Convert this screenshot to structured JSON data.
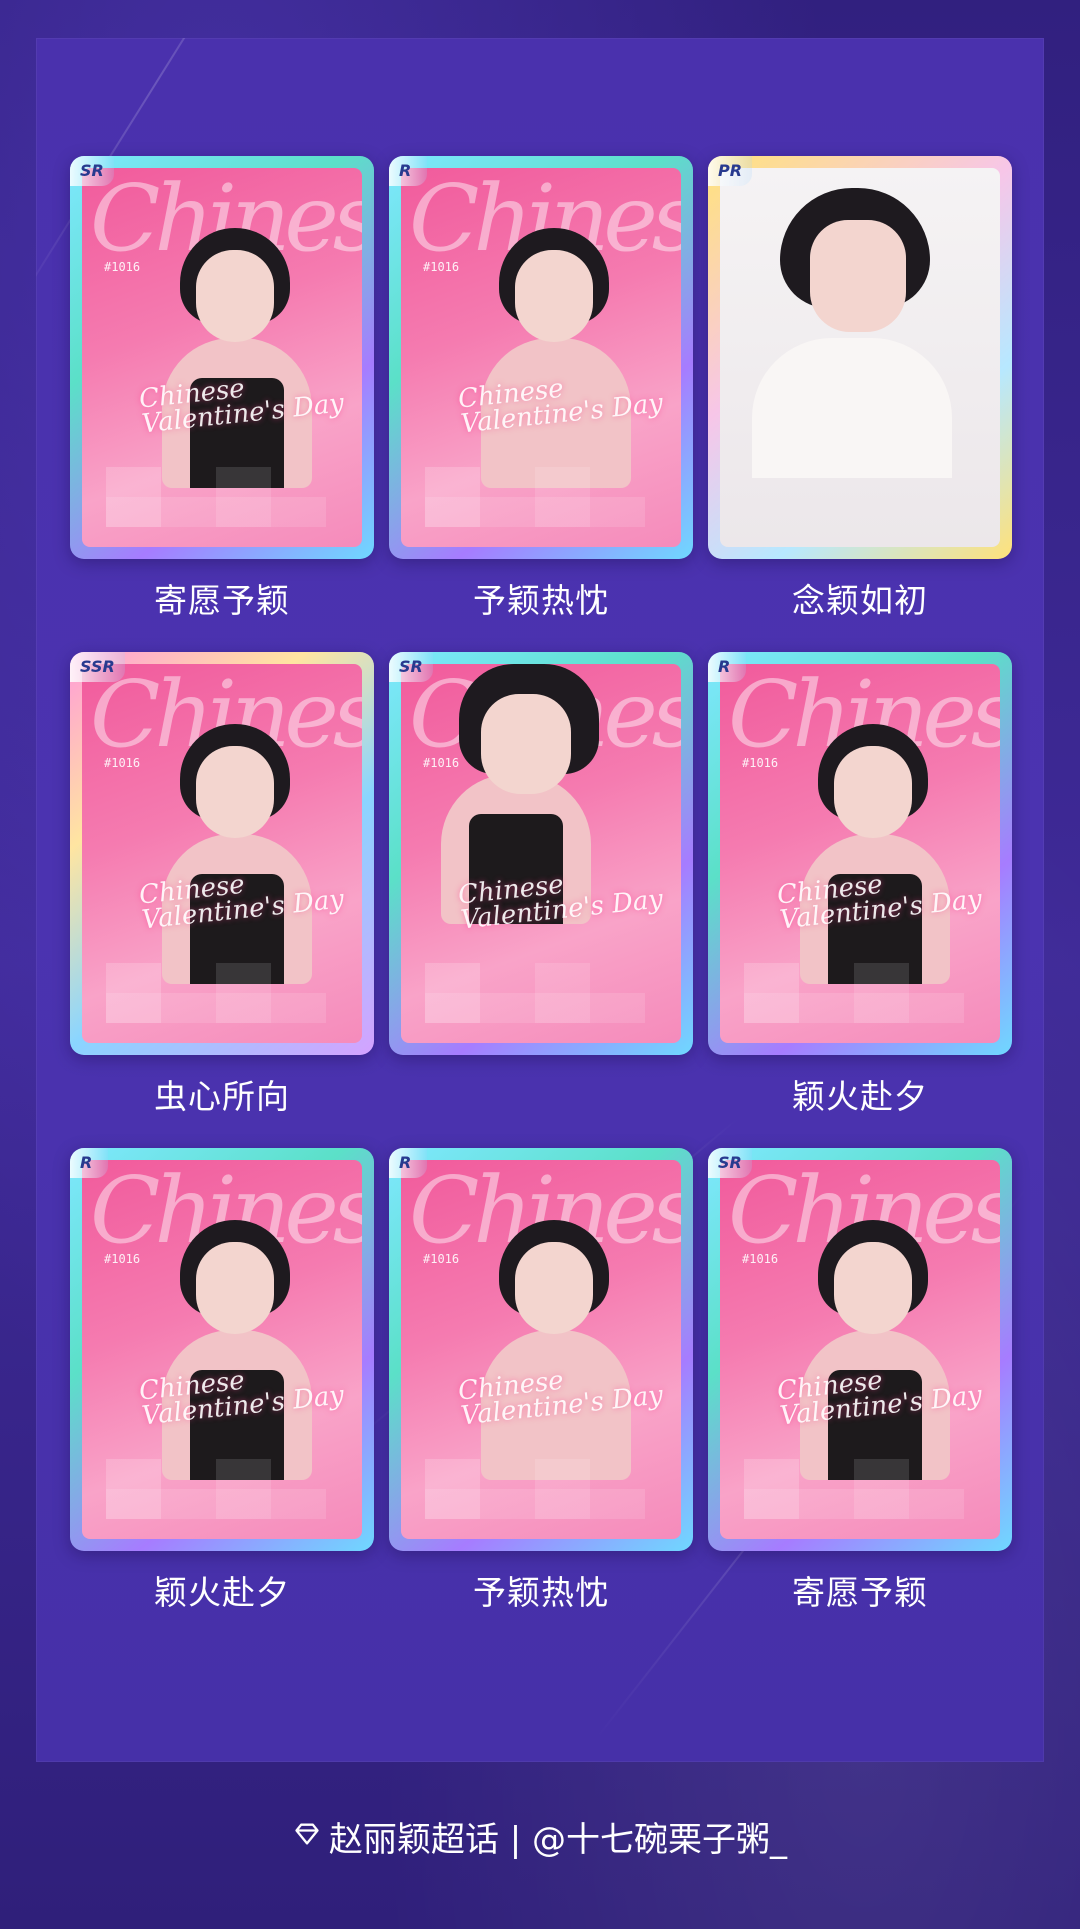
{
  "cards": [
    {
      "rarity": "SR",
      "name": "寄愿予颖"
    },
    {
      "rarity": "R",
      "name": "予颖热忱"
    },
    {
      "rarity": "PR",
      "name": "念颖如初"
    },
    {
      "rarity": "SSR",
      "name": "虫心所向"
    },
    {
      "rarity": "SR",
      "name": ""
    },
    {
      "rarity": "R",
      "name": "颖火赴夕"
    },
    {
      "rarity": "R",
      "name": "颖火赴夕"
    },
    {
      "rarity": "R",
      "name": "予颖热忱"
    },
    {
      "rarity": "SR",
      "name": "寄愿予颖"
    }
  ],
  "card_text": {
    "script": "Chinese",
    "number": "#1016",
    "valentine": "Chinese Valentine's Day"
  },
  "footer": {
    "icon": "diamond-icon",
    "text": "赵丽颖超话 | @十七碗栗子粥_"
  }
}
